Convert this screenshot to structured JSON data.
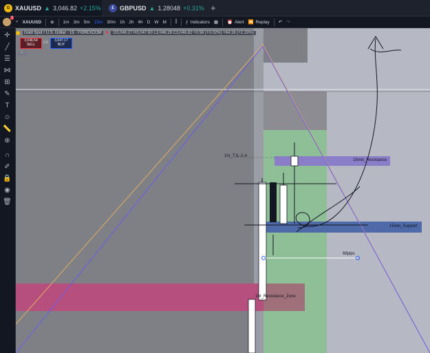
{
  "tabs": [
    {
      "symbol": "XAUUSD",
      "price": "3,046.82",
      "change": "+2.15%",
      "logo_color": "#f0b90b"
    },
    {
      "symbol": "GBPUSD",
      "price": "1.28048",
      "change": "+0.31%",
      "logo_color": "#3c4ba0"
    }
  ],
  "tab_plus": "+",
  "toolbar": {
    "symbol": "XAUUSD",
    "intervals": [
      "1m",
      "3m",
      "5m",
      "15m",
      "30m",
      "1h",
      "2h",
      "4h",
      "D",
      "W",
      "M"
    ],
    "active_interval": "15m",
    "indicators_label": "Indicators",
    "alert_label": "Alert",
    "replay_label": "Replay",
    "avatar_badge": "2"
  },
  "legend": {
    "title": "Gold Spot / U.S. Dollar · 15 · FOREXCOM",
    "ohlc": "O3,046.27 H3,047.60 L3,046.28 C3,046.82 +0.56 (+0.02%) +64.16 (+2.19%)",
    "sell_price": "3,046.54",
    "sell_label": "SELL",
    "spread": "0.6",
    "buy_price": "3,047.17",
    "buy_label": "BUY"
  },
  "zones": {
    "resistance_15m": "15min_Resistance",
    "support_15m": "15min_Support",
    "tjl_label": "1hr_TJL-2-A",
    "measure_label": "68pips",
    "resistance_zone": "1hr_Resistance_Zone"
  },
  "colors": {
    "chart_bg": "#b6b8c4",
    "dark_zone": "#787880",
    "green_zone": "#8fbf97",
    "resistance_zone": "#b64f7d",
    "support_band": "#4e6aa8",
    "resistance_band": "#8a7ec8",
    "orange_line": "#e0b060",
    "purple_line": "#6a5af0"
  }
}
